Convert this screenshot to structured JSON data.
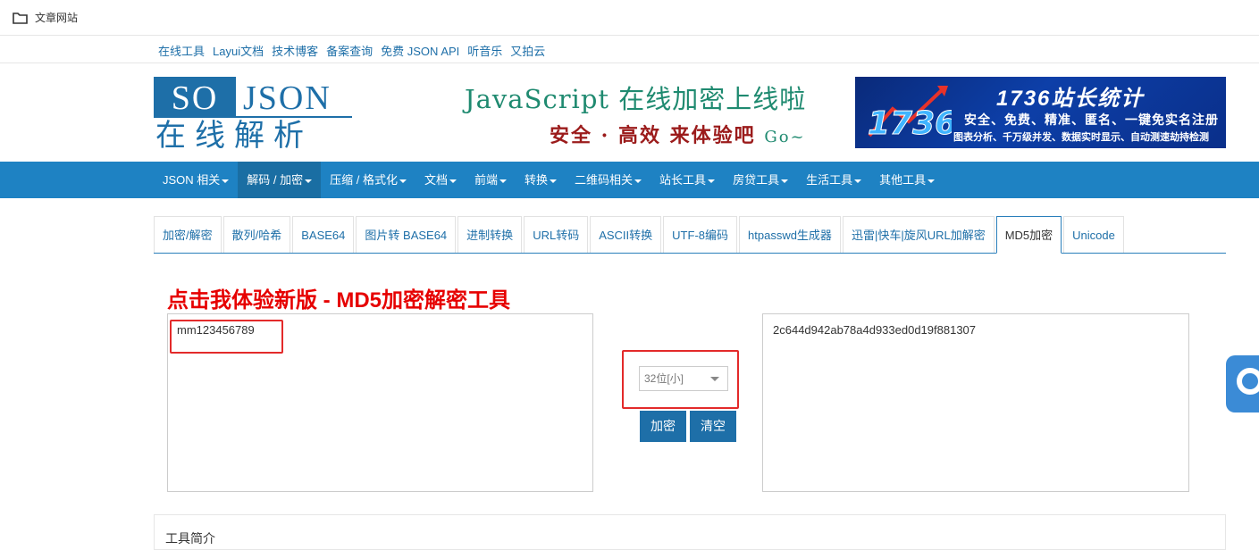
{
  "bookmark": {
    "label": "文章网站",
    "icon": "folder-icon"
  },
  "top_links": [
    "在线工具",
    "Layui文档",
    "技术博客",
    "备案查询",
    "免费 JSON API",
    "听音乐",
    "又拍云"
  ],
  "logo": {
    "so": "SO",
    "json": "JSON",
    "sub": "在线解析"
  },
  "ad": {
    "line1": "JavaScript 在线加密上线啦",
    "line2": "安全 · 高效  来体验吧",
    "go": "Go~"
  },
  "stat_banner": {
    "emblem": "1736",
    "title": "1736站长统计",
    "line2": "安全、免费、精准、匿名、一键免实名注册",
    "line3": "图表分析、千万级并发、数据实时显示、自动测速劫持检测"
  },
  "nav": {
    "items": [
      "JSON 相关",
      "解码 / 加密",
      "压缩 / 格式化",
      "文档",
      "前端",
      "转换",
      "二维码相关",
      "站长工具",
      "房贷工具",
      "生活工具",
      "其他工具"
    ],
    "active_index": 1
  },
  "tabs": {
    "items": [
      "加密/解密",
      "散列/哈希",
      "BASE64",
      "图片转 BASE64",
      "进制转换",
      "URL转码",
      "ASCII转换",
      "UTF-8编码",
      "htpasswd生成器",
      "迅雷|快车|旋风URL加解密",
      "MD5加密",
      "Unicode"
    ],
    "active_index": 10
  },
  "promo": "点击我体验新版 - MD5加密解密工具",
  "input": {
    "value": "mm123456789"
  },
  "output": {
    "value": "2c644d942ab78a4d933ed0d19f881307"
  },
  "select": {
    "value": "32位[小]"
  },
  "buttons": {
    "encrypt": "加密",
    "clear": "清空"
  },
  "intro": {
    "title": "工具简介"
  },
  "colors": {
    "primary": "#1e82c3",
    "link": "#1e6fa8",
    "highlight": "#e32a2a",
    "promo": "#e60000"
  }
}
